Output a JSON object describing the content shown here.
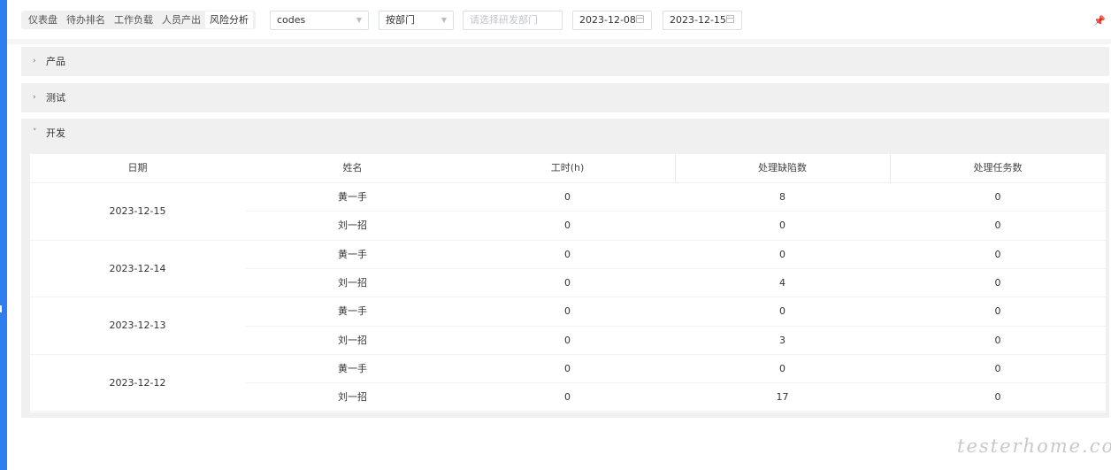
{
  "toolbar": {
    "tabs": [
      {
        "label": "仪表盘"
      },
      {
        "label": "待办排名"
      },
      {
        "label": "工作负载"
      },
      {
        "label": "人员产出"
      },
      {
        "label": "风险分析"
      }
    ],
    "active_tab": "风险分析",
    "project_select": {
      "value": "codes"
    },
    "group_select": {
      "value": "按部门"
    },
    "dept_select": {
      "placeholder": "请选择研发部门"
    },
    "start_date": "2023-12-08",
    "end_date": "2023-12-15"
  },
  "panels": {
    "product": {
      "label": "产品",
      "expanded": false
    },
    "test": {
      "label": "测试",
      "expanded": false
    },
    "dev": {
      "label": "开发",
      "expanded": true
    }
  },
  "table": {
    "headers": [
      "日期",
      "姓名",
      "工时(h)",
      "处理缺陷数",
      "处理任务数"
    ],
    "groups": [
      {
        "date": "2023-12-15",
        "rows": [
          {
            "name": "黄一手",
            "hours": "0",
            "defects": "8",
            "tasks": "0"
          },
          {
            "name": "刘一招",
            "hours": "0",
            "defects": "0",
            "tasks": "0"
          }
        ]
      },
      {
        "date": "2023-12-14",
        "rows": [
          {
            "name": "黄一手",
            "hours": "0",
            "defects": "0",
            "tasks": "0"
          },
          {
            "name": "刘一招",
            "hours": "0",
            "defects": "4",
            "tasks": "0"
          }
        ]
      },
      {
        "date": "2023-12-13",
        "rows": [
          {
            "name": "黄一手",
            "hours": "0",
            "defects": "0",
            "tasks": "0"
          },
          {
            "name": "刘一招",
            "hours": "0",
            "defects": "3",
            "tasks": "0"
          }
        ]
      },
      {
        "date": "2023-12-12",
        "rows": [
          {
            "name": "黄一手",
            "hours": "0",
            "defects": "0",
            "tasks": "0"
          },
          {
            "name": "刘一招",
            "hours": "0",
            "defects": "17",
            "tasks": "0"
          }
        ]
      }
    ]
  },
  "watermark": "testerhome.com",
  "colors": {
    "accent": "#2d7ff0",
    "panel_bg": "#f0f0f0"
  },
  "icons": {
    "pin": "pin-icon",
    "calendar": "calendar-icon",
    "caret": "chevron-down-icon",
    "collapsed": "chevron-right-icon",
    "expanded": "chevron-down-icon"
  }
}
